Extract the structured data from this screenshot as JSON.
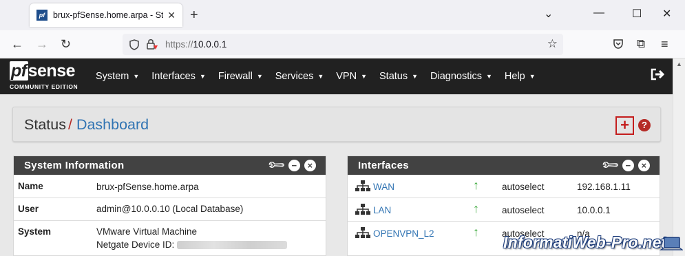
{
  "browser": {
    "tab_title": "brux-pfSense.home.arpa - Status",
    "favicon_text": "pf",
    "url_prefix": "https://",
    "url_host": "10.0.0.1"
  },
  "logo": {
    "pf": "pf",
    "sense": "sense",
    "edition": "COMMUNITY EDITION"
  },
  "menu": [
    {
      "label": "System"
    },
    {
      "label": "Interfaces"
    },
    {
      "label": "Firewall"
    },
    {
      "label": "Services"
    },
    {
      "label": "VPN"
    },
    {
      "label": "Status"
    },
    {
      "label": "Diagnostics"
    },
    {
      "label": "Help"
    }
  ],
  "breadcrumb": {
    "parent": "Status",
    "separator": "/",
    "current": "Dashboard"
  },
  "system_info": {
    "title": "System Information",
    "rows": [
      {
        "key": "Name",
        "value": "brux-pfSense.home.arpa"
      },
      {
        "key": "User",
        "value": "admin@10.0.0.10 (Local Database)"
      },
      {
        "key": "System",
        "value": "VMware Virtual Machine",
        "value2": "Netgate Device ID:"
      }
    ]
  },
  "interfaces": {
    "title": "Interfaces",
    "rows": [
      {
        "name": "WAN",
        "media": "autoselect",
        "ip": "192.168.1.11"
      },
      {
        "name": "LAN",
        "media": "autoselect",
        "ip": "10.0.0.1"
      },
      {
        "name": "OPENVPN_L2",
        "media": "autoselect",
        "ip": "n/a"
      }
    ]
  },
  "watermark": "InformatiWeb-Pro.net",
  "colors": {
    "header_bg": "#212121",
    "panel_head_bg": "#424242",
    "link_blue": "#3174b3",
    "accent_red": "#b52b27",
    "status_up_green": "#3aa83a"
  }
}
